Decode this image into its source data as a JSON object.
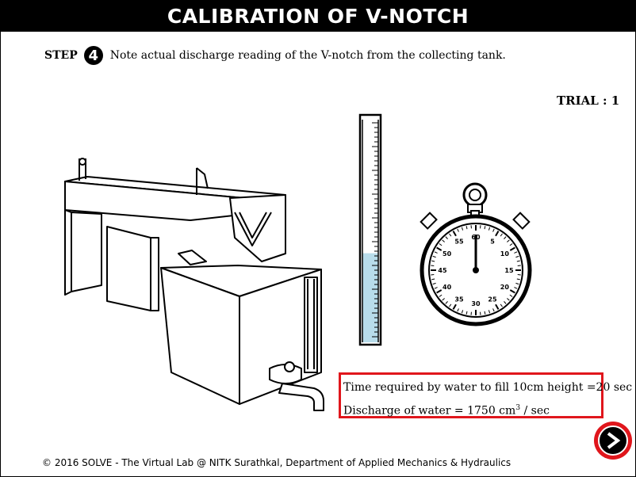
{
  "header": {
    "title": "CALIBRATION OF V-NOTCH"
  },
  "step": {
    "label": "STEP",
    "number": "4",
    "instruction": "Note actual discharge reading of the V-notch from the collecting tank."
  },
  "trial": {
    "label": "TRIAL : 1"
  },
  "stopwatch": {
    "dial_labels": [
      "60",
      "5",
      "10",
      "15",
      "20",
      "25",
      "30",
      "35",
      "40",
      "45",
      "50",
      "55"
    ]
  },
  "tube": {
    "water_level_fraction": 0.4
  },
  "results": {
    "time_text": "Time required by water to fill 10cm height =20 sec",
    "discharge_prefix": "Discharge of water = 1750 cm",
    "discharge_exponent": "3",
    "discharge_suffix": " / sec"
  },
  "footer": {
    "copyright": "© 2016 SOLVE - The Virtual Lab @ NITK Surathkal, Department of Applied Mechanics & Hydraulics"
  },
  "colors": {
    "header_bg": "#000000",
    "accent_red": "#e0161c",
    "water": "#b8dcea"
  },
  "icons": {
    "next": "arrow-right-icon"
  }
}
